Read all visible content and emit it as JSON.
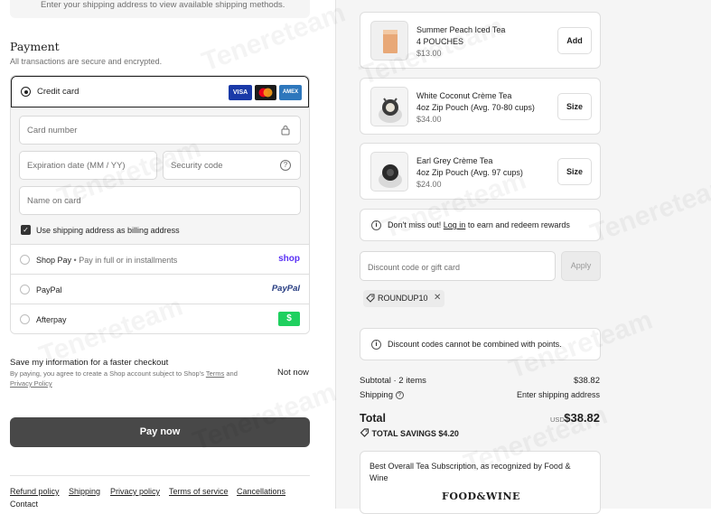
{
  "shipping_note": "Enter your shipping address to view available shipping methods.",
  "payment": {
    "title": "Payment",
    "subtitle": "All transactions are secure and encrypted.",
    "credit_card_label": "Credit card",
    "card_logos": [
      "VISA",
      "",
      "AMEX"
    ],
    "card_number_placeholder": "Card number",
    "expiration_placeholder": "Expiration date (MM / YY)",
    "security_code_placeholder": "Security code",
    "name_placeholder": "Name on card",
    "billing_checkbox_label": "Use shipping address as billing address",
    "options": [
      {
        "label": "Shop Pay",
        "sub": "• Pay in full or in installments",
        "brand": "shop"
      },
      {
        "label": "PayPal",
        "brand": "PayPal"
      },
      {
        "label": "Afterpay",
        "brand": "$"
      }
    ]
  },
  "save_info": {
    "title": "Save my information for a faster checkout",
    "sub_text": "By paying, you agree to create a Shop account subject to Shop's",
    "terms": "Terms",
    "and": "and",
    "privacy": "Privacy Policy",
    "not_now": "Not now"
  },
  "pay_button": "Pay now",
  "footer_links": [
    "Refund policy",
    "Shipping",
    "Privacy policy",
    "Terms of service",
    "Cancellations",
    "Contact"
  ],
  "cart_items": [
    {
      "name": "Summer Peach Iced Tea",
      "variant": "4 POUCHES",
      "price": "$13.00",
      "button": "Add"
    },
    {
      "name": "White Coconut Crème Tea",
      "variant": "4oz Zip Pouch (Avg. 70-80 cups)",
      "price": "$34.00",
      "button": "Size"
    },
    {
      "name": "Earl Grey Crème Tea",
      "variant": "4oz Zip Pouch (Avg. 97 cups)",
      "price": "$24.00",
      "button": "Size"
    }
  ],
  "rewards_notice": {
    "prefix": "Don't miss out!",
    "link": "Log in",
    "suffix": "to earn and redeem rewards"
  },
  "discount": {
    "placeholder": "Discount code or gift card",
    "apply": "Apply",
    "applied_code": "ROUNDUP10",
    "notice": "Discount codes cannot be combined with points."
  },
  "summary": {
    "subtotal_label": "Subtotal · 2 items",
    "subtotal_value": "$38.82",
    "shipping_label": "Shipping",
    "shipping_value": "Enter shipping address",
    "total_label": "Total",
    "currency": "USD",
    "total_value": "$38.82",
    "savings_label": "TOTAL SAVINGS",
    "savings_value": "$4.20"
  },
  "promo": {
    "text": "Best Overall Tea Subscription, as recognized by Food & Wine",
    "logo": "FOOD&WINE"
  },
  "watermark": "Tenereteam"
}
